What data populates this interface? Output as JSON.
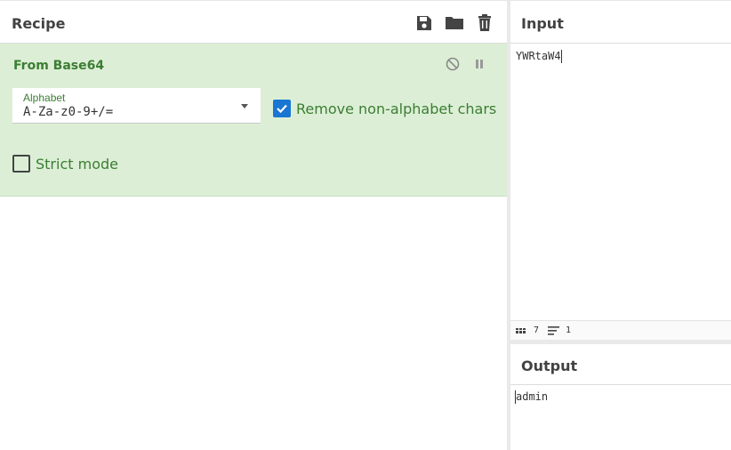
{
  "recipe": {
    "title": "Recipe",
    "icons": [
      "save-icon",
      "folder-icon",
      "trash-icon"
    ]
  },
  "operation": {
    "name": "From Base64",
    "alphabet_label": "Alphabet",
    "alphabet_value": "A-Za-z0-9+/=",
    "remove_nonalpha_label": "Remove non-alphabet chars",
    "remove_nonalpha_checked": true,
    "strict_mode_label": "Strict mode",
    "strict_mode_checked": false
  },
  "input": {
    "title": "Input",
    "value": "YWRtaW4",
    "char_count": "7",
    "line_count": "1"
  },
  "output": {
    "title": "Output",
    "value": "admin"
  },
  "colors": {
    "op_bg": "#dcefd6",
    "op_text": "#3c7d33",
    "checkbox_checked": "#1976d2"
  }
}
